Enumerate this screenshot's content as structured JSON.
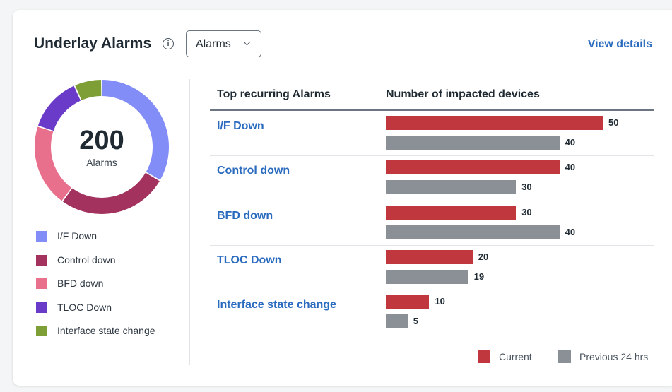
{
  "header": {
    "title": "Underlay Alarms",
    "info_icon": "info-icon",
    "dropdown_value": "Alarms",
    "view_details": "View details"
  },
  "summary": {
    "total": "200",
    "total_label": "Alarms"
  },
  "table": {
    "col_alarm": "Top recurring Alarms",
    "col_devices": "Number of impacted devices"
  },
  "colors": {
    "current": "#c0383d",
    "previous": "#8a9096",
    "link": "#2a6bbf"
  },
  "legend": {
    "current": "Current",
    "previous": "Previous 24 hrs"
  },
  "chart_data": {
    "type": "bar",
    "orientation": "horizontal",
    "categories": [
      "I/F Down",
      "Control down",
      "BFD down",
      "TLOC Down",
      "Interface state change"
    ],
    "series": [
      {
        "name": "Current",
        "values": [
          50,
          40,
          30,
          20,
          10
        ],
        "color": "#c0383d"
      },
      {
        "name": "Previous 24 hrs",
        "values": [
          40,
          30,
          40,
          19,
          5
        ],
        "color": "#8a9096"
      }
    ],
    "xlim": [
      0,
      56
    ],
    "grid": false,
    "legend_position": "bottom-right"
  },
  "donut": {
    "total": 200,
    "slices": [
      {
        "label": "I/F Down",
        "color": "#838df8"
      },
      {
        "label": "Control down",
        "color": "#a3325f"
      },
      {
        "label": "BFD down",
        "color": "#e8708d"
      },
      {
        "label": "TLOC Down",
        "color": "#6a3bc9"
      },
      {
        "label": "Interface state change",
        "color": "#7e9f35"
      }
    ]
  }
}
